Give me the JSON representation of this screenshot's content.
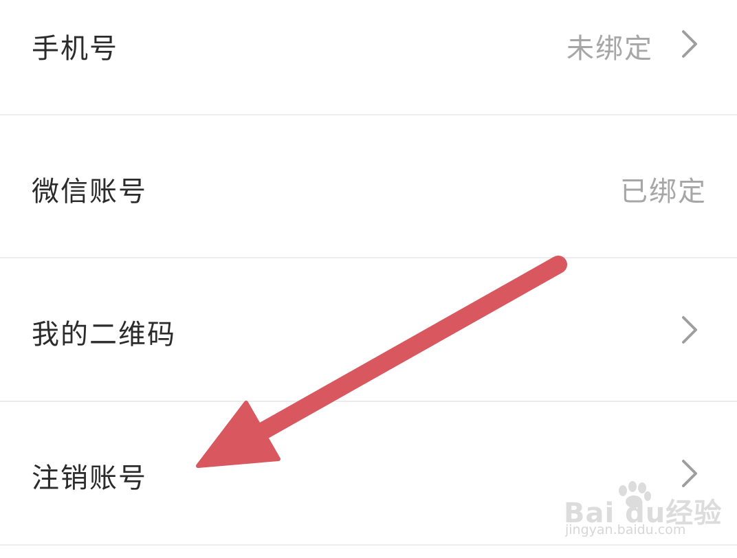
{
  "settings": {
    "rows": [
      {
        "label": "手机号",
        "value": "未绑定",
        "has_chevron": true
      },
      {
        "label": "微信账号",
        "value": "已绑定",
        "has_chevron": false
      },
      {
        "label": "我的二维码",
        "value": "",
        "has_chevron": true
      },
      {
        "label": "注销账号",
        "value": "",
        "has_chevron": true
      }
    ]
  },
  "annotation": {
    "type": "arrow",
    "color": "#d9575e"
  },
  "watermark": {
    "brand": "Bai du经验",
    "url": "jingyan.baidu.com"
  },
  "colors": {
    "background": "#ffffff",
    "label_text": "#2b2b2b",
    "value_text": "#a6a6a6",
    "chevron": "#9e9e9e",
    "divider": "#ececec"
  },
  "icons": {
    "chevron": "chevron-right-icon"
  }
}
